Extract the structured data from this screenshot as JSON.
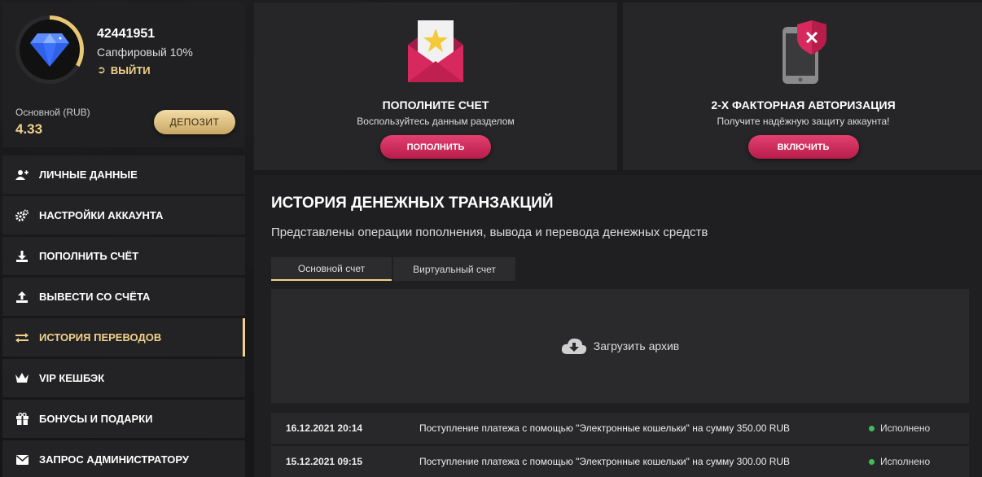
{
  "profile": {
    "user_id": "42441951",
    "level": "Сапфировый 10%",
    "logout_label": "ВЫЙТИ",
    "balance_label": "Основной (RUB)",
    "balance_value": "4.33",
    "deposit_label": "ДЕПОЗИТ"
  },
  "menu": {
    "items": [
      {
        "label": "ЛИЧНЫЕ ДАННЫЕ",
        "icon": "user-add-icon"
      },
      {
        "label": "НАСТРОЙКИ АККАУНТА",
        "icon": "gears-icon"
      },
      {
        "label": "ПОПОЛНИТЬ СЧЁТ",
        "icon": "download-icon"
      },
      {
        "label": "ВЫВЕСТИ СО СЧЁТА",
        "icon": "upload-icon"
      },
      {
        "label": "ИСТОРИЯ ПЕРЕВОДОВ",
        "icon": "transfer-arrows-icon",
        "active": true
      },
      {
        "label": "VIP КЕШБЭК",
        "icon": "crown-icon"
      },
      {
        "label": "БОНУСЫ И ПОДАРКИ",
        "icon": "gift-icon"
      },
      {
        "label": "ЗАПРОС АДМИНИСТРАТОРУ",
        "icon": "mail-icon"
      }
    ]
  },
  "cards": {
    "deposit": {
      "title": "ПОПОЛНИТЕ СЧЕТ",
      "subtitle": "Воспользуйтесь данным разделом",
      "button": "ПОПОЛНИТЬ"
    },
    "twofa": {
      "title": "2-Х ФАКТОРНАЯ АВТОРИЗАЦИЯ",
      "subtitle": "Получите надёжную защиту аккаунта!",
      "button": "ВКЛЮЧИТЬ"
    }
  },
  "history": {
    "title": "ИСТОРИЯ ДЕНЕЖНЫХ ТРАНЗАКЦИЙ",
    "description": "Представлены операции пополнения, вывода и перевода денежных средств",
    "tabs": [
      "Основной счет",
      "Виртуальный счет"
    ],
    "archive_label": "Загрузить архив",
    "rows": [
      {
        "date": "16.12.2021 20:14",
        "description": "Поступление платежа с помощью \"Электронные кошельки\" на сумму 350.00 RUB",
        "status": "Исполнено"
      },
      {
        "date": "15.12.2021 09:15",
        "description": "Поступление платежа с помощью \"Электронные кошельки\" на сумму 300.00 RUB",
        "status": "Исполнено"
      }
    ]
  },
  "colors": {
    "accent_gold": "#f1d28a",
    "button_red": "#c8255a",
    "status_green": "#3bbf5a"
  }
}
